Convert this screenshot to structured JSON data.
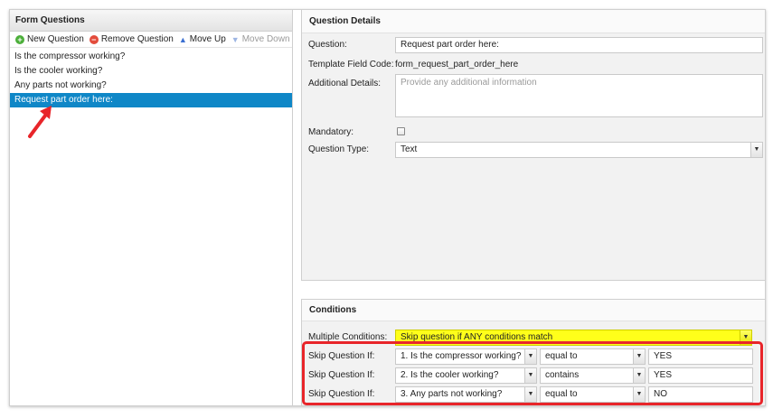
{
  "form_questions": {
    "title": "Form Questions",
    "toolbar": {
      "new_label": "New Question",
      "remove_label": "Remove Question",
      "up_label": "Move Up",
      "down_label": "Move Down"
    },
    "items": [
      {
        "label": "Is the compressor working?"
      },
      {
        "label": "Is the cooler working?"
      },
      {
        "label": "Any parts not working?"
      },
      {
        "label": "Request part order here:",
        "selected": true
      }
    ]
  },
  "question_details": {
    "title": "Question Details",
    "question_label": "Question:",
    "question_value": "Request part order here:",
    "field_code_label": "Template Field Code:",
    "field_code_value": "form_request_part_order_here",
    "additional_label": "Additional Details:",
    "additional_placeholder": "Provide any additional information",
    "mandatory_label": "Mandatory:",
    "mandatory_checked": false,
    "type_label": "Question Type:",
    "type_value": "Text"
  },
  "conditions": {
    "title": "Conditions",
    "multiple_label": "Multiple Conditions:",
    "multiple_value": "Skip question if ANY conditions match",
    "highlight_color": "#ffff1a",
    "rows": [
      {
        "label": "Skip Question If:",
        "question": "1. Is the compressor working?",
        "operator": "equal to",
        "value": "YES"
      },
      {
        "label": "Skip Question If:",
        "question": "2. Is the cooler working?",
        "operator": "contains",
        "value": "YES"
      },
      {
        "label": "Skip Question If:",
        "question": "3. Any parts not working?",
        "operator": "equal to",
        "value": "NO"
      }
    ]
  },
  "annotation_color": "#e8252a"
}
